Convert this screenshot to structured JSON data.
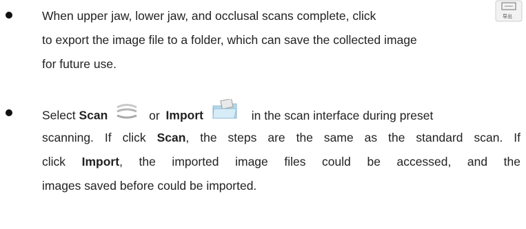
{
  "item1": {
    "line1": "When upper jaw, lower jaw, and occlusal scans complete, click",
    "line2": "to export the image file to a folder, which can save the collected image",
    "line3": "for future use.",
    "export_icon_caption": "导出"
  },
  "item2": {
    "select": "Select",
    "scan": "Scan",
    "or": "or",
    "import": "Import",
    "rest1": "in the scan interface during preset",
    "line2a": "scanning. If click",
    "line2b": ", the steps are the same as the standard scan. If",
    "line3a": "click",
    "line3b": ", the imported image files could be accessed, and the",
    "line4": "images saved before could be imported."
  },
  "icons": {
    "export": "export-icon",
    "scan": "scanner-icon",
    "import": "import-folder-icon"
  }
}
